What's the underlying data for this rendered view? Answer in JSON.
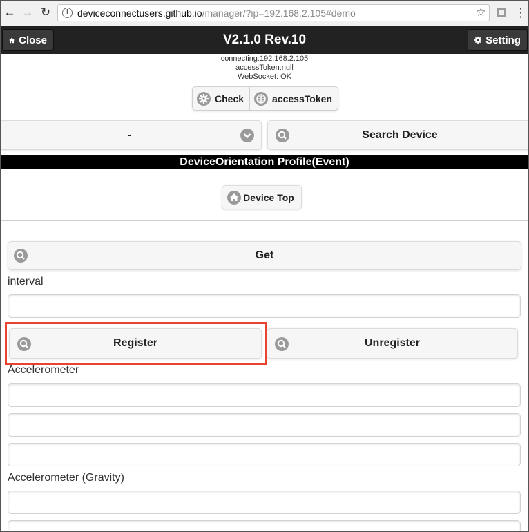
{
  "browser": {
    "url_host": "deviceconnectusers.github.io",
    "url_path": "/manager/?ip=192.168.2.105#demo",
    "info_icon": "info-icon",
    "bookmark_icon": "star-icon"
  },
  "header": {
    "close_label": "Close",
    "title": "V2.1.0 Rev.10",
    "setting_label": "Setting"
  },
  "status": {
    "connecting": "connecting:192.168.2.105",
    "access_token": "accessToken:null",
    "websocket": "WebSocket: OK"
  },
  "toolbar": {
    "check_label": "Check",
    "access_token_label": "accessToken"
  },
  "device_select": {
    "value": "-",
    "search_label": "Search Device"
  },
  "section": {
    "title": "DeviceOrientation Profile(Event)"
  },
  "device_top_label": "Device Top",
  "get_label": "Get",
  "interval": {
    "label": "interval",
    "value": ""
  },
  "register_label": "Register",
  "unregister_label": "Unregister",
  "accelerometer": {
    "label": "Accelerometer",
    "values": [
      "",
      "",
      ""
    ]
  },
  "accelerometer_gravity": {
    "label": "Accelerometer (Gravity)",
    "values": [
      "",
      ""
    ]
  },
  "colors": {
    "header_bg": "#222222",
    "section_bg": "#000000",
    "highlight": "#e8432f",
    "icon_circle": "#9a9a9a"
  }
}
